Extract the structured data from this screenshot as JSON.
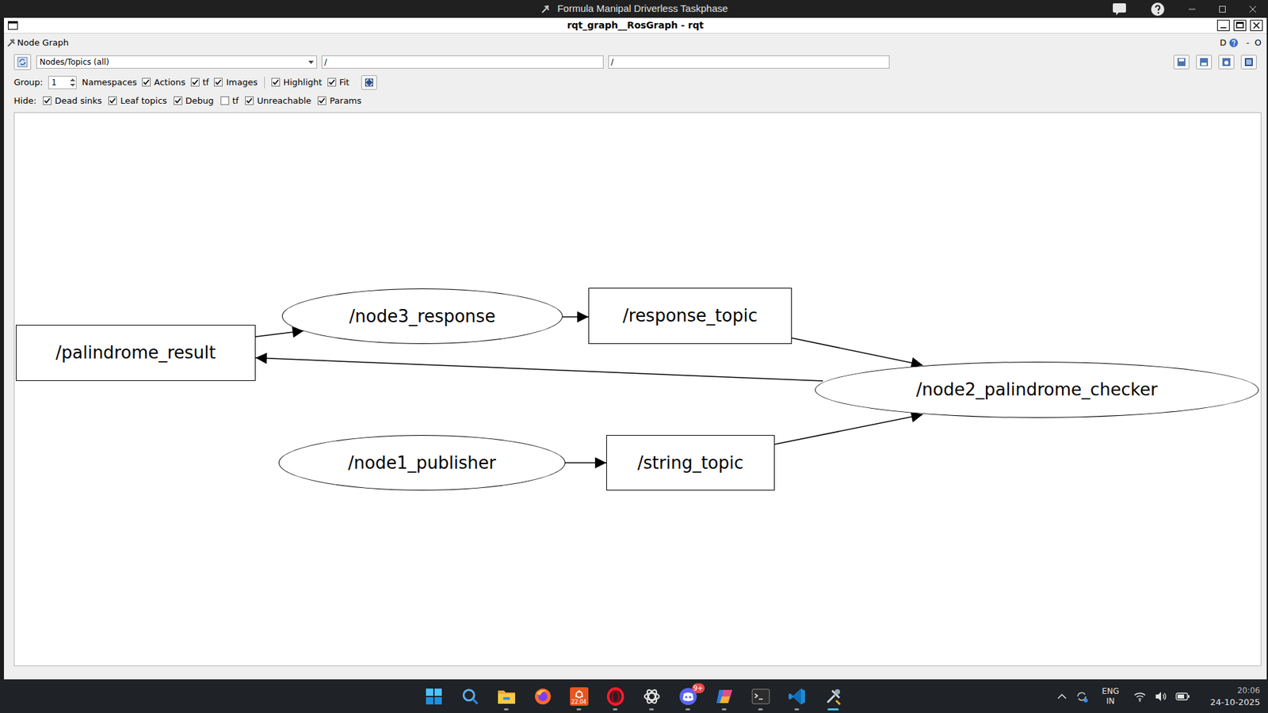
{
  "outer_window": {
    "title": "Formula Manipal Driverless Taskphase"
  },
  "window": {
    "title": "rqt_graph__RosGraph - rqt"
  },
  "plugin": {
    "title": "Node Graph",
    "corner_dock": "D",
    "corner_min": "-",
    "corner_close": "O"
  },
  "toolbar": {
    "mode": "Nodes/Topics (all)",
    "filter_in": "/",
    "filter_out": "/"
  },
  "group": {
    "label": "Group:",
    "value": "1",
    "namespaces": "Namespaces"
  },
  "display_options": [
    {
      "label": "Actions",
      "checked": true
    },
    {
      "label": "tf",
      "checked": true
    },
    {
      "label": "Images",
      "checked": true
    },
    {
      "label": "Highlight",
      "checked": true
    },
    {
      "label": "Fit",
      "checked": true
    }
  ],
  "hide": {
    "label": "Hide:",
    "options": [
      {
        "label": "Dead sinks",
        "checked": true
      },
      {
        "label": "Leaf topics",
        "checked": true
      },
      {
        "label": "Debug",
        "checked": true
      },
      {
        "label": "tf",
        "checked": false
      },
      {
        "label": "Unreachable",
        "checked": true
      },
      {
        "label": "Params",
        "checked": true
      }
    ]
  },
  "graph": {
    "nodes": [
      {
        "label": "/palindrome_result",
        "kind": "topic"
      },
      {
        "label": "/node3_response",
        "kind": "node"
      },
      {
        "label": "/response_topic",
        "kind": "topic"
      },
      {
        "label": "/node2_palindrome_checker",
        "kind": "node"
      },
      {
        "label": "/node1_publisher",
        "kind": "node"
      },
      {
        "label": "/string_topic",
        "kind": "topic"
      }
    ],
    "edges": [
      {
        "from": "/palindrome_result",
        "to": "/node3_response"
      },
      {
        "from": "/node3_response",
        "to": "/response_topic"
      },
      {
        "from": "/response_topic",
        "to": "/node2_palindrome_checker"
      },
      {
        "from": "/node2_palindrome_checker",
        "to": "/palindrome_result"
      },
      {
        "from": "/node1_publisher",
        "to": "/string_topic"
      },
      {
        "from": "/string_topic",
        "to": "/node2_palindrome_checker"
      }
    ]
  },
  "taskbar": {
    "ubuntu_version": "22.04",
    "badge": "9+",
    "language": "ENG",
    "region": "IN",
    "time": "20:06",
    "date": "24-10-2025"
  }
}
